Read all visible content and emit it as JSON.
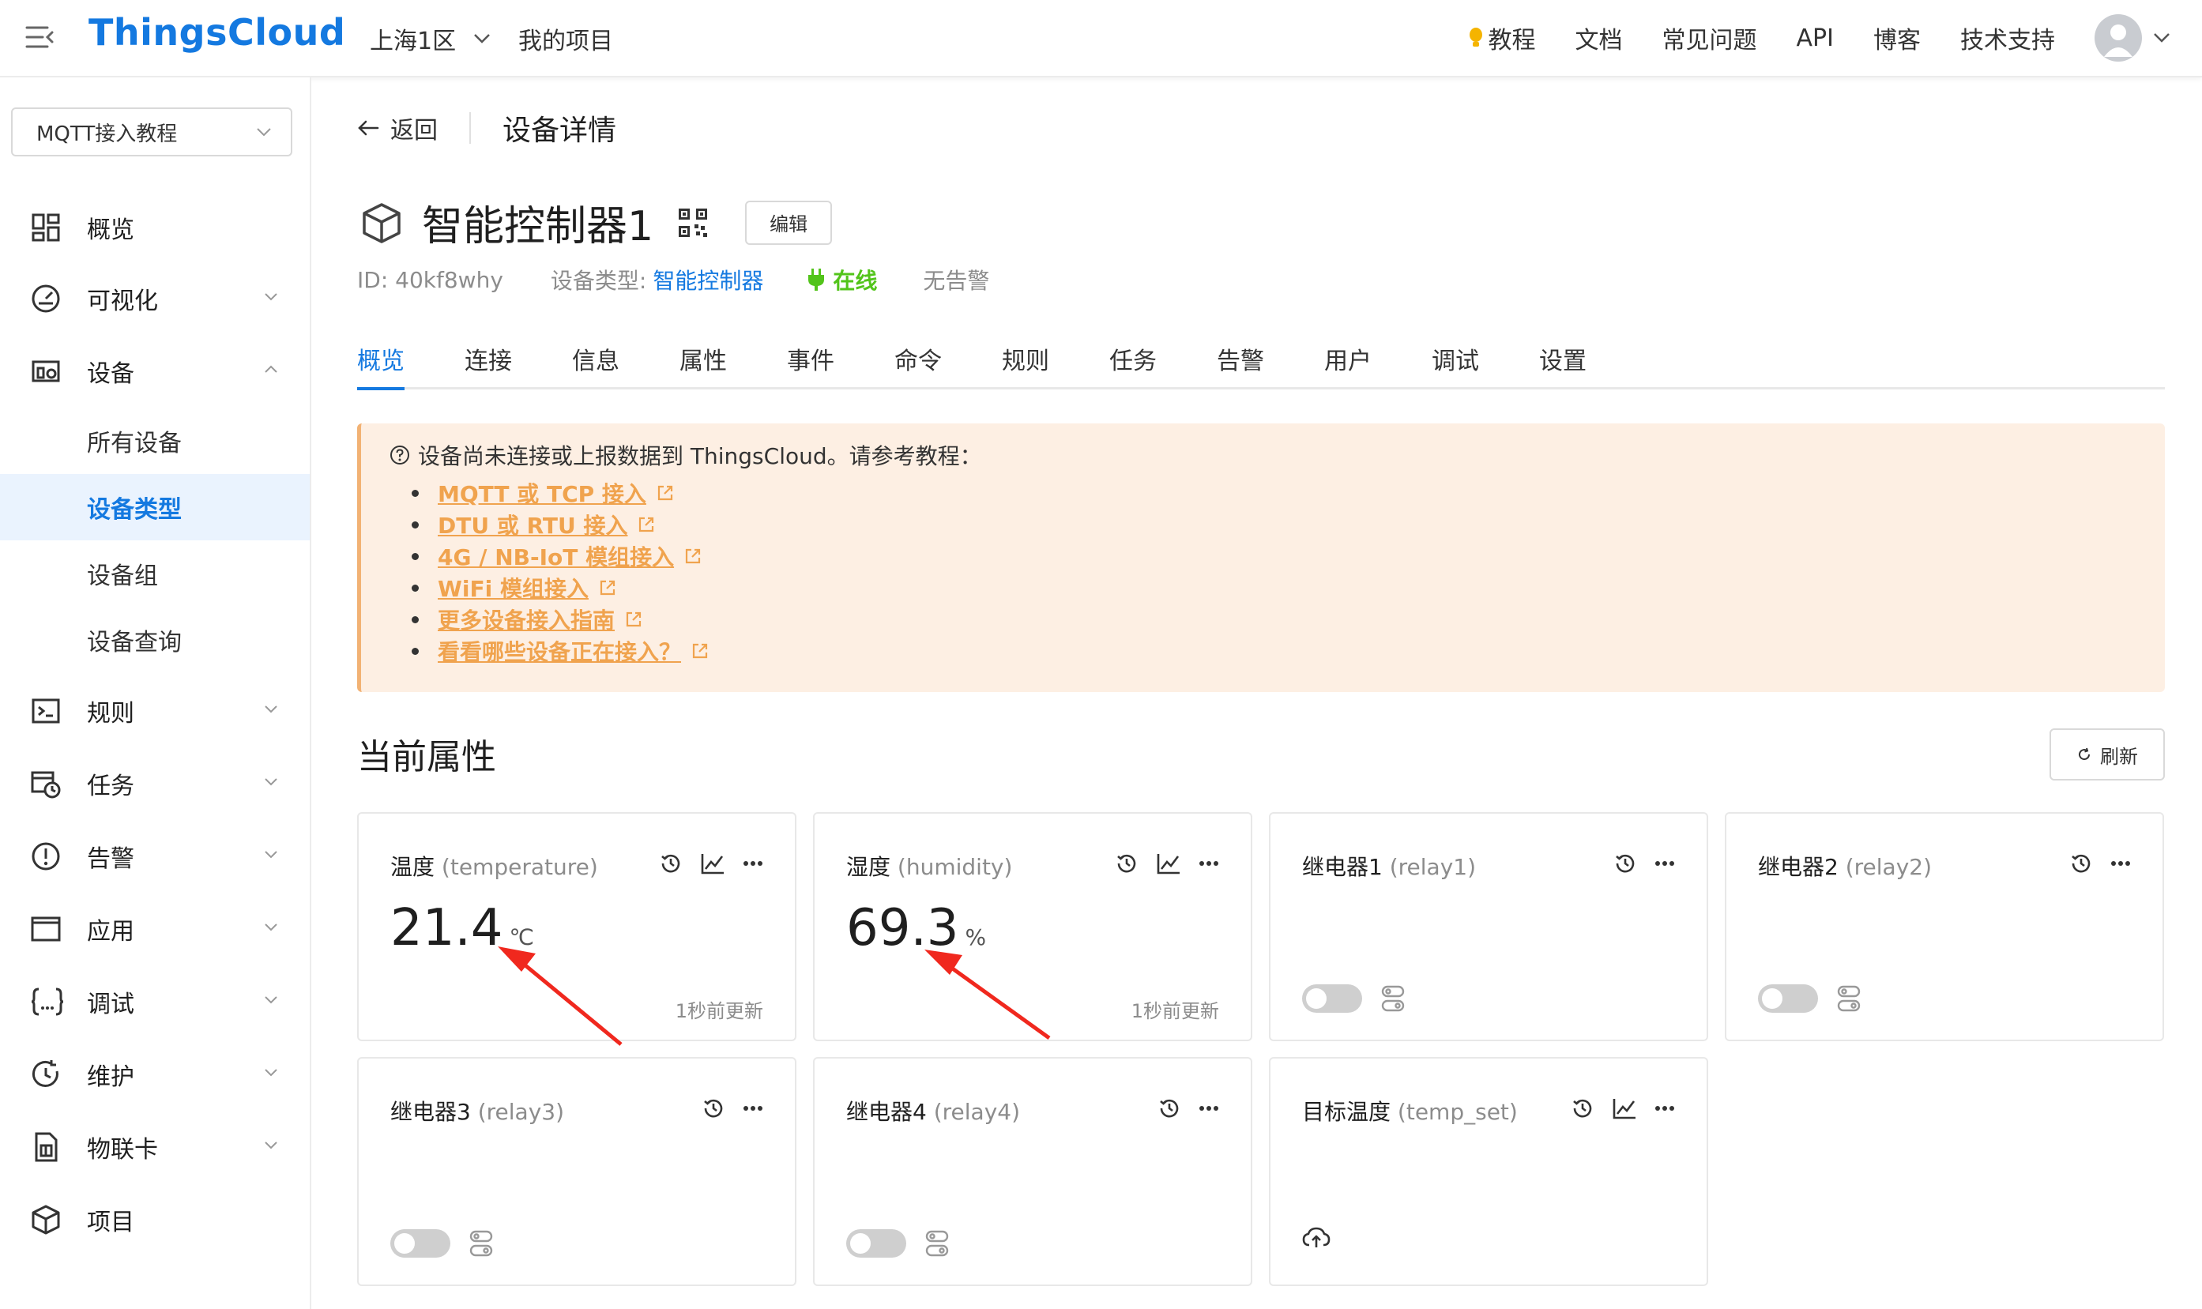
{
  "header": {
    "brand": "ThingsCloud",
    "region": "上海1区",
    "my_projects": "我的项目",
    "nav": [
      {
        "label": "教程",
        "icon": "lightbulb-icon"
      },
      {
        "label": "文档"
      },
      {
        "label": "常见问题"
      },
      {
        "label": "API"
      },
      {
        "label": "博客"
      },
      {
        "label": "技术支持"
      }
    ]
  },
  "sidebar": {
    "project_select": "MQTT接入教程",
    "items": [
      {
        "label": "概览",
        "icon": "dashboard-grid-icon"
      },
      {
        "label": "可视化",
        "icon": "gauge-icon"
      },
      {
        "label": "设备",
        "icon": "device-icon"
      },
      {
        "label": "所有设备"
      },
      {
        "label": "设备类型"
      },
      {
        "label": "设备组"
      },
      {
        "label": "设备查询"
      },
      {
        "label": "规则",
        "icon": "terminal-icon"
      },
      {
        "label": "任务",
        "icon": "task-calendar-icon"
      },
      {
        "label": "告警",
        "icon": "alert-icon"
      },
      {
        "label": "应用",
        "icon": "app-window-icon"
      },
      {
        "label": "调试",
        "icon": "code-braces-icon"
      },
      {
        "label": "维护",
        "icon": "maintenance-icon"
      },
      {
        "label": "物联卡",
        "icon": "sim-card-icon"
      },
      {
        "label": "项目",
        "icon": "project-box-icon"
      }
    ]
  },
  "page": {
    "back": "返回",
    "title": "设备详情",
    "device_name": "智能控制器1",
    "edit": "编辑",
    "id_text": "ID: 40kf8why",
    "type_label": "设备类型:",
    "type_value": "智能控制器",
    "status": "在线",
    "alarm": "无告警"
  },
  "tabs": [
    "概览",
    "连接",
    "信息",
    "属性",
    "事件",
    "命令",
    "规则",
    "任务",
    "告警",
    "用户",
    "调试",
    "设置"
  ],
  "notice": {
    "title": "设备尚未连接或上报数据到 ThingsCloud。请参考教程：",
    "links": [
      "MQTT 或 TCP 接入",
      "DTU 或 RTU 接入",
      "4G / NB-IoT 模组接入",
      "WiFi 模组接入",
      "更多设备接入指南",
      "看看哪些设备正在接入？"
    ]
  },
  "properties": {
    "section_title": "当前属性",
    "refresh": "刷新",
    "cards": [
      {
        "name": "温度",
        "key": "(temperature)",
        "value": "21.4",
        "unit": "℃",
        "updated": "1秒前更新"
      },
      {
        "name": "湿度",
        "key": "(humidity)",
        "value": "69.3",
        "unit": "%",
        "updated": "1秒前更新"
      },
      {
        "name": "继电器1",
        "key": "(relay1)",
        "toggle": false
      },
      {
        "name": "继电器2",
        "key": "(relay2)",
        "toggle": false
      },
      {
        "name": "继电器3",
        "key": "(relay3)",
        "toggle": false
      },
      {
        "name": "继电器4",
        "key": "(relay4)",
        "toggle": false
      },
      {
        "name": "目标温度",
        "key": "(temp_set)",
        "icon": "cloud-upload-icon"
      }
    ]
  },
  "colors": {
    "brand": "#1479e0",
    "online": "#52c41a",
    "notice_bg": "#fdefe3",
    "notice_link": "#f0a34e",
    "annotation_arrow": "#f0281e"
  }
}
